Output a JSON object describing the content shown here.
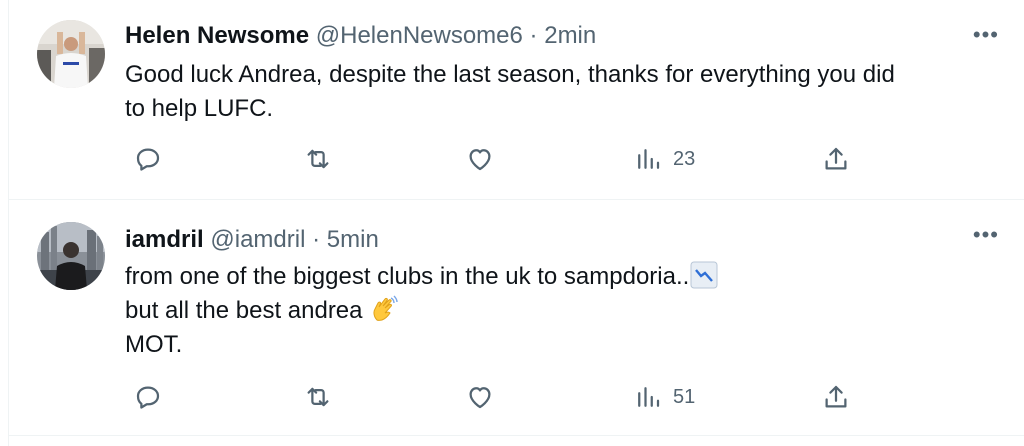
{
  "tweets": [
    {
      "name": "Helen Newsome",
      "handle": "@HelenNewsome6",
      "time": "2min",
      "lines": [
        "Good luck Andrea, despite the last season, thanks for everything you did",
        "to help LUFC."
      ],
      "views": "23"
    },
    {
      "name": "iamdril",
      "handle": "@iamdril",
      "time": "5min",
      "lines": [
        "from one of the biggest clubs in the uk to sampdoria..",
        "but all the best andrea",
        "MOT."
      ],
      "views": "51"
    }
  ],
  "separator": "·",
  "more": "•••",
  "icons": [
    "reply-icon",
    "retweet-icon",
    "like-icon",
    "views-icon",
    "share-icon",
    "chart-decreasing-emoji",
    "waving-hand-emoji"
  ],
  "colors": {
    "text": "#0f1419",
    "secondary": "#536471",
    "border": "#eff3f4"
  }
}
